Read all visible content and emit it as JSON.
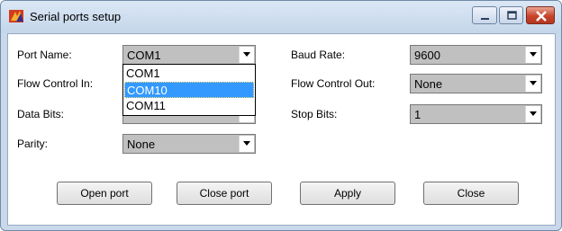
{
  "window": {
    "title": "Serial ports setup"
  },
  "colors": {
    "selection": "#3399ff",
    "close_button": "#c8432b",
    "frame": "#c9d9eb"
  },
  "fields": {
    "port_name": {
      "label": "Port Name:",
      "value": "COM1"
    },
    "baud_rate": {
      "label": "Baud Rate:",
      "value": "9600"
    },
    "flow_control_in": {
      "label": "Flow Control In:",
      "value": ""
    },
    "flow_control_out": {
      "label": "Flow Control Out:",
      "value": "None"
    },
    "data_bits": {
      "label": "Data Bits:",
      "value": ""
    },
    "stop_bits": {
      "label": "Stop Bits:",
      "value": "1"
    },
    "parity": {
      "label": "Parity:",
      "value": "None"
    }
  },
  "port_dropdown": {
    "options": [
      "COM1",
      "COM10",
      "COM11"
    ],
    "highlighted": "COM10"
  },
  "buttons": {
    "open_port": "Open port",
    "close_port": "Close port",
    "apply": "Apply",
    "close": "Close"
  }
}
